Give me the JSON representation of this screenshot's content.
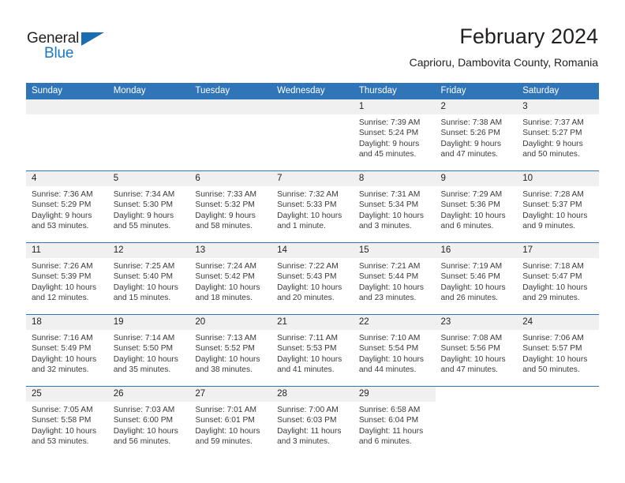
{
  "brand": {
    "name_top": "General",
    "name_bottom": "Blue",
    "accent_color": "#1b6cb0"
  },
  "header": {
    "month_title": "February 2024",
    "location": "Caprioru, Dambovita County, Romania"
  },
  "theme": {
    "header_blue": "#3075b8",
    "daynum_band": "#f0f0f0",
    "text": "#231f20"
  },
  "weekday_headers": [
    "Sunday",
    "Monday",
    "Tuesday",
    "Wednesday",
    "Thursday",
    "Friday",
    "Saturday"
  ],
  "labels": {
    "sunrise_prefix": "Sunrise:",
    "sunset_prefix": "Sunset:",
    "daylight_prefix": "Daylight:"
  },
  "weeks": [
    [
      {
        "day": "",
        "blank": true
      },
      {
        "day": "",
        "blank": true
      },
      {
        "day": "",
        "blank": true
      },
      {
        "day": "",
        "blank": true
      },
      {
        "day": "1",
        "sunrise": "Sunrise: 7:39 AM",
        "sunset": "Sunset: 5:24 PM",
        "daylight": "Daylight: 9 hours and 45 minutes."
      },
      {
        "day": "2",
        "sunrise": "Sunrise: 7:38 AM",
        "sunset": "Sunset: 5:26 PM",
        "daylight": "Daylight: 9 hours and 47 minutes."
      },
      {
        "day": "3",
        "sunrise": "Sunrise: 7:37 AM",
        "sunset": "Sunset: 5:27 PM",
        "daylight": "Daylight: 9 hours and 50 minutes."
      }
    ],
    [
      {
        "day": "4",
        "sunrise": "Sunrise: 7:36 AM",
        "sunset": "Sunset: 5:29 PM",
        "daylight": "Daylight: 9 hours and 53 minutes."
      },
      {
        "day": "5",
        "sunrise": "Sunrise: 7:34 AM",
        "sunset": "Sunset: 5:30 PM",
        "daylight": "Daylight: 9 hours and 55 minutes."
      },
      {
        "day": "6",
        "sunrise": "Sunrise: 7:33 AM",
        "sunset": "Sunset: 5:32 PM",
        "daylight": "Daylight: 9 hours and 58 minutes."
      },
      {
        "day": "7",
        "sunrise": "Sunrise: 7:32 AM",
        "sunset": "Sunset: 5:33 PM",
        "daylight": "Daylight: 10 hours and 1 minute."
      },
      {
        "day": "8",
        "sunrise": "Sunrise: 7:31 AM",
        "sunset": "Sunset: 5:34 PM",
        "daylight": "Daylight: 10 hours and 3 minutes."
      },
      {
        "day": "9",
        "sunrise": "Sunrise: 7:29 AM",
        "sunset": "Sunset: 5:36 PM",
        "daylight": "Daylight: 10 hours and 6 minutes."
      },
      {
        "day": "10",
        "sunrise": "Sunrise: 7:28 AM",
        "sunset": "Sunset: 5:37 PM",
        "daylight": "Daylight: 10 hours and 9 minutes."
      }
    ],
    [
      {
        "day": "11",
        "sunrise": "Sunrise: 7:26 AM",
        "sunset": "Sunset: 5:39 PM",
        "daylight": "Daylight: 10 hours and 12 minutes."
      },
      {
        "day": "12",
        "sunrise": "Sunrise: 7:25 AM",
        "sunset": "Sunset: 5:40 PM",
        "daylight": "Daylight: 10 hours and 15 minutes."
      },
      {
        "day": "13",
        "sunrise": "Sunrise: 7:24 AM",
        "sunset": "Sunset: 5:42 PM",
        "daylight": "Daylight: 10 hours and 18 minutes."
      },
      {
        "day": "14",
        "sunrise": "Sunrise: 7:22 AM",
        "sunset": "Sunset: 5:43 PM",
        "daylight": "Daylight: 10 hours and 20 minutes."
      },
      {
        "day": "15",
        "sunrise": "Sunrise: 7:21 AM",
        "sunset": "Sunset: 5:44 PM",
        "daylight": "Daylight: 10 hours and 23 minutes."
      },
      {
        "day": "16",
        "sunrise": "Sunrise: 7:19 AM",
        "sunset": "Sunset: 5:46 PM",
        "daylight": "Daylight: 10 hours and 26 minutes."
      },
      {
        "day": "17",
        "sunrise": "Sunrise: 7:18 AM",
        "sunset": "Sunset: 5:47 PM",
        "daylight": "Daylight: 10 hours and 29 minutes."
      }
    ],
    [
      {
        "day": "18",
        "sunrise": "Sunrise: 7:16 AM",
        "sunset": "Sunset: 5:49 PM",
        "daylight": "Daylight: 10 hours and 32 minutes."
      },
      {
        "day": "19",
        "sunrise": "Sunrise: 7:14 AM",
        "sunset": "Sunset: 5:50 PM",
        "daylight": "Daylight: 10 hours and 35 minutes."
      },
      {
        "day": "20",
        "sunrise": "Sunrise: 7:13 AM",
        "sunset": "Sunset: 5:52 PM",
        "daylight": "Daylight: 10 hours and 38 minutes."
      },
      {
        "day": "21",
        "sunrise": "Sunrise: 7:11 AM",
        "sunset": "Sunset: 5:53 PM",
        "daylight": "Daylight: 10 hours and 41 minutes."
      },
      {
        "day": "22",
        "sunrise": "Sunrise: 7:10 AM",
        "sunset": "Sunset: 5:54 PM",
        "daylight": "Daylight: 10 hours and 44 minutes."
      },
      {
        "day": "23",
        "sunrise": "Sunrise: 7:08 AM",
        "sunset": "Sunset: 5:56 PM",
        "daylight": "Daylight: 10 hours and 47 minutes."
      },
      {
        "day": "24",
        "sunrise": "Sunrise: 7:06 AM",
        "sunset": "Sunset: 5:57 PM",
        "daylight": "Daylight: 10 hours and 50 minutes."
      }
    ],
    [
      {
        "day": "25",
        "sunrise": "Sunrise: 7:05 AM",
        "sunset": "Sunset: 5:58 PM",
        "daylight": "Daylight: 10 hours and 53 minutes."
      },
      {
        "day": "26",
        "sunrise": "Sunrise: 7:03 AM",
        "sunset": "Sunset: 6:00 PM",
        "daylight": "Daylight: 10 hours and 56 minutes."
      },
      {
        "day": "27",
        "sunrise": "Sunrise: 7:01 AM",
        "sunset": "Sunset: 6:01 PM",
        "daylight": "Daylight: 10 hours and 59 minutes."
      },
      {
        "day": "28",
        "sunrise": "Sunrise: 7:00 AM",
        "sunset": "Sunset: 6:03 PM",
        "daylight": "Daylight: 11 hours and 3 minutes."
      },
      {
        "day": "29",
        "sunrise": "Sunrise: 6:58 AM",
        "sunset": "Sunset: 6:04 PM",
        "daylight": "Daylight: 11 hours and 6 minutes."
      },
      {
        "day": "",
        "blank": true
      },
      {
        "day": "",
        "blank": true
      }
    ]
  ]
}
